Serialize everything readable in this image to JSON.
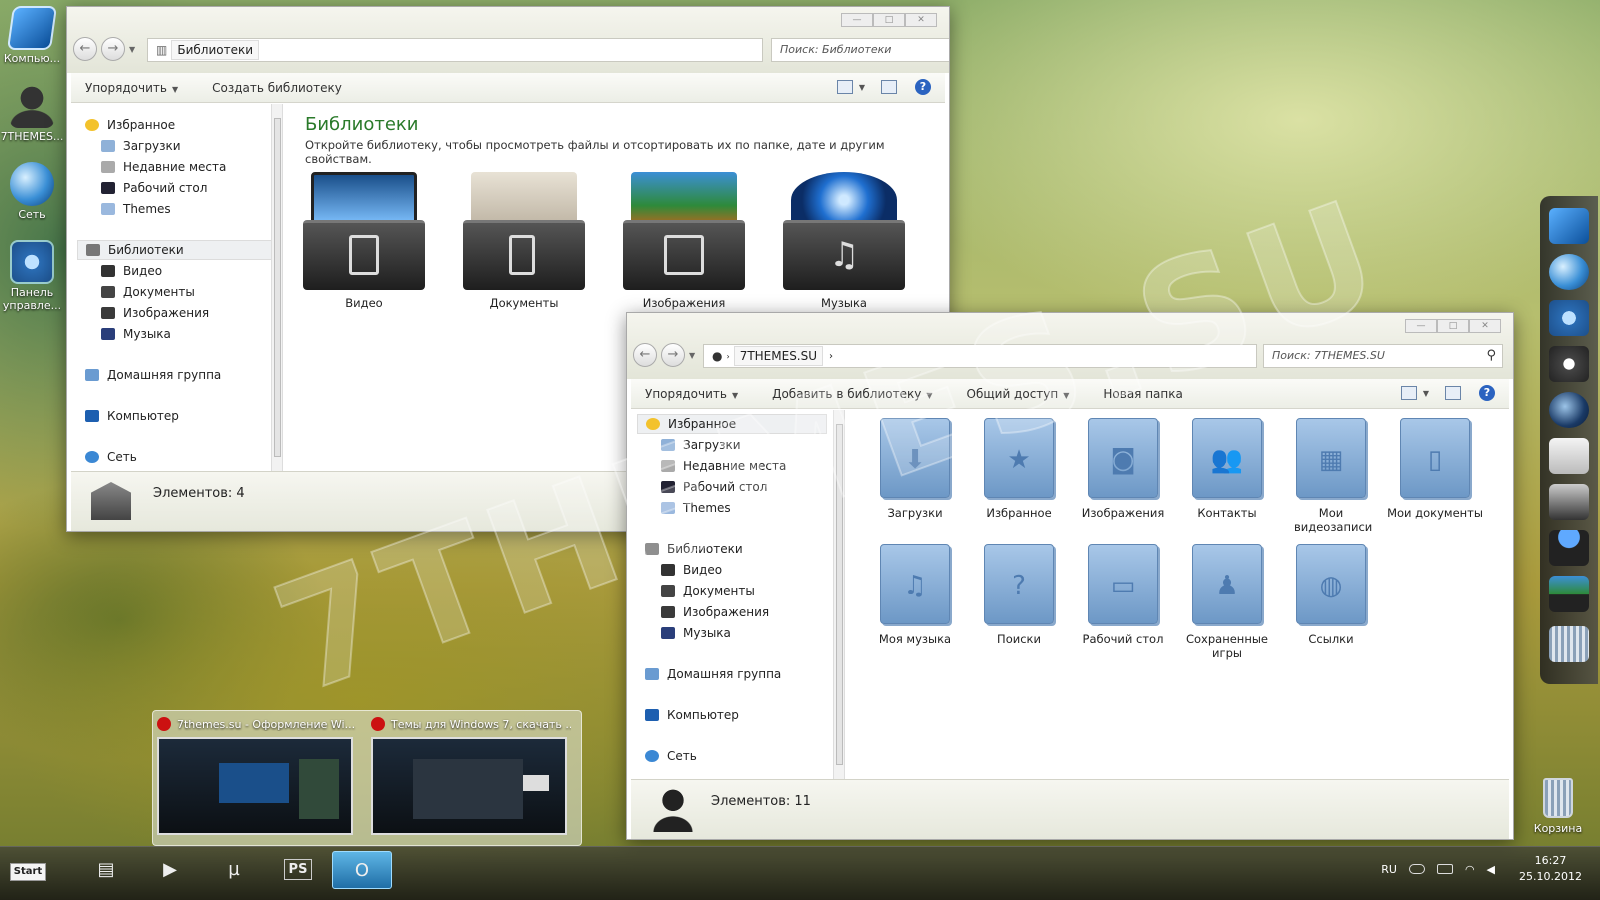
{
  "watermark": "7THEMES.SU",
  "desktop": {
    "icons": [
      {
        "label": "Компью...",
        "icon": "computer-icon"
      },
      {
        "label": "7THEMES...",
        "icon": "user-icon"
      },
      {
        "label": "Сеть",
        "icon": "network-globe-icon"
      },
      {
        "label": "Панель управле...",
        "icon": "control-panel-icon"
      }
    ],
    "recycle_bin": "Корзина"
  },
  "window1": {
    "address": "Библиотеки",
    "search_placeholder": "Поиск: Библиотеки",
    "toolbar": {
      "organize": "Упорядочить",
      "create_library": "Создать библиотеку"
    },
    "nav": {
      "favorites": "Избранное",
      "downloads": "Загрузки",
      "recent": "Недавние места",
      "desktop": "Рабочий стол",
      "themes": "Themes",
      "libraries": "Библиотеки",
      "video": "Видео",
      "documents": "Документы",
      "images": "Изображения",
      "music": "Музыка",
      "homegroup": "Домашняя группа",
      "computer": "Компьютер",
      "network": "Сеть"
    },
    "content": {
      "title": "Библиотеки",
      "description": "Откройте библиотеку, чтобы просмотреть файлы и отсортировать их по папке, дате и другим свойствам.",
      "items": [
        {
          "label": "Видео",
          "icon": "video-library-icon"
        },
        {
          "label": "Документы",
          "icon": "documents-library-icon"
        },
        {
          "label": "Изображения",
          "icon": "images-library-icon"
        },
        {
          "label": "Музыка",
          "icon": "music-library-icon"
        }
      ]
    },
    "status": "Элементов: 4"
  },
  "window2": {
    "address": "7THEMES.SU",
    "search_placeholder": "Поиск: 7THEMES.SU",
    "toolbar": {
      "organize": "Упорядочить",
      "add_to_library": "Добавить в библиотеку",
      "share": "Общий доступ",
      "new_folder": "Новая папка"
    },
    "nav": {
      "favorites": "Избранное",
      "downloads": "Загрузки",
      "recent": "Недавние места",
      "desktop": "Рабочий стол",
      "themes": "Themes",
      "libraries": "Библиотеки",
      "video": "Видео",
      "documents": "Документы",
      "images": "Изображения",
      "music": "Музыка",
      "homegroup": "Домашняя группа",
      "computer": "Компьютер",
      "network": "Сеть"
    },
    "folders": [
      {
        "label": "Загрузки",
        "symbol": "⬇"
      },
      {
        "label": "Избранное",
        "symbol": "★"
      },
      {
        "label": "Изображения",
        "symbol": "◙"
      },
      {
        "label": "Контакты",
        "symbol": "👥"
      },
      {
        "label": "Мои видеозаписи",
        "symbol": "▦"
      },
      {
        "label": "Мои документы",
        "symbol": "▯"
      },
      {
        "label": "Моя музыка",
        "symbol": "♫"
      },
      {
        "label": "Поиски",
        "symbol": "?"
      },
      {
        "label": "Рабочий стол",
        "symbol": "▭"
      },
      {
        "label": "Сохраненные игры",
        "symbol": "♟"
      },
      {
        "label": "Ссылки",
        "symbol": "◍"
      }
    ],
    "status": "Элементов: 11"
  },
  "thumbnails": [
    {
      "title": "7themes.su - Оформление Wi..."
    },
    {
      "title": "Темы для Windows 7, скачать ..."
    }
  ],
  "taskbar": {
    "start": "Start",
    "ps_label": "PS",
    "language": "RU",
    "time": "16:27",
    "date": "25.10.2012"
  }
}
